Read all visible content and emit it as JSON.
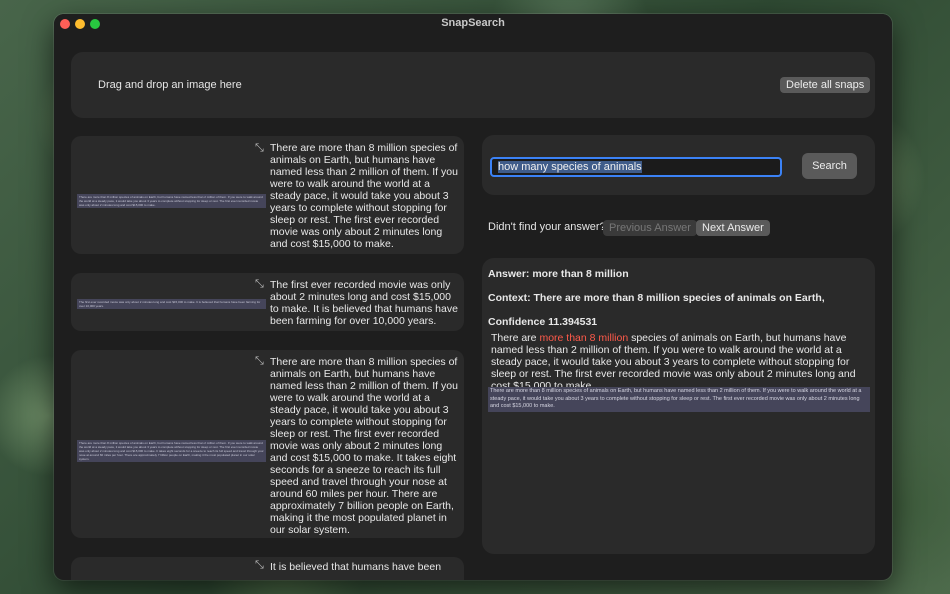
{
  "app": {
    "title": "SnapSearch"
  },
  "drop_zone": {
    "label": "Drag and drop an image here"
  },
  "toolbar": {
    "delete_all": "Delete all snaps"
  },
  "snaps": [
    {
      "thumb_text": "There are more than 8 million species of animals on Earth, but humans have named less than 2 million of them. If you were to walk around the world at a steady pace, it would take you about 3 years to complete without stopping for sleep or rest. The first ever recorded movie was only about 2 minutes long and cost $15,000 to make.",
      "text": "There are more than 8 million species of animals on Earth, but humans have named less than 2 million of them. If you were to walk around the world at a steady pace, it would take you about 3 years to complete without stopping for sleep or rest. The first ever recorded movie was only about 2 minutes long and cost $15,000 to make."
    },
    {
      "thumb_text": "The first ever recorded movie was only about 2 minutes long and cost $15,000 to make. It is believed that humans have been farming for over 10,000 years.",
      "text": "The first ever recorded movie was only about 2 minutes long and cost $15,000 to make. It is believed that humans have been farming for over 10,000 years."
    },
    {
      "thumb_text": "There are more than 8 million species of animals on Earth, but humans have named less than 2 million of them. If you were to walk around the world at a steady pace, it would take you about 3 years to complete without stopping for sleep or rest. The first ever recorded movie was only about 2 minutes long and cost $15,000 to make. It takes eight seconds for a sneeze to reach its full speed and travel through your nose at around 60 miles per hour. There are approximately 7 billion people on Earth, making it the most populated planet in our solar system.",
      "text": "There are more than 8 million species of animals on Earth, but humans have named less than 2 million of them. If you were to walk around the world at a steady pace, it would take you about 3 years to complete without stopping for sleep or rest. The first ever recorded movie was only about 2 minutes long and cost $15,000 to make. It takes eight seconds for a sneeze to reach its full speed and travel through your nose at around 60 miles per hour. There are approximately 7 billion people on Earth, making it the most populated planet in our solar system."
    },
    {
      "thumb_text": "",
      "text": "It is believed that humans have been"
    }
  ],
  "search": {
    "value": "how many species of animals",
    "button": "Search"
  },
  "nav": {
    "prompt": "Didn't find your answer?",
    "previous": "Previous Answer",
    "next": "Next Answer"
  },
  "answer": {
    "answer_line": "Answer: more than 8 million",
    "context_line": "Context: There are more than 8 million species of animals on Earth,",
    "confidence_line": "Confidence 11.394531",
    "context_before": "There are ",
    "context_highlight": "more than 8 million",
    "context_after": " species of animals on Earth, but humans have named less than 2 million of them. If you were to walk around the world at a steady pace, it would take you about 3 years to complete without stopping for sleep or rest. The first ever recorded movie was only about 2 minutes long and cost $15,000 to make.",
    "thumb_text": "There are more than 8 million species of animals on Earth, but humans have named less than 2 million of them. If you were to walk around the world at a steady pace, it would take you about 3 years to complete without stopping for sleep or rest. The first ever recorded movie was only about 2 minutes long and cost $15,000 to make."
  },
  "colors": {
    "highlight": "#ff5a4a",
    "focus_ring": "#3b82f6",
    "thumb_bg": "#45455a"
  },
  "icons": {
    "expand": "expand-arrows-icon"
  }
}
